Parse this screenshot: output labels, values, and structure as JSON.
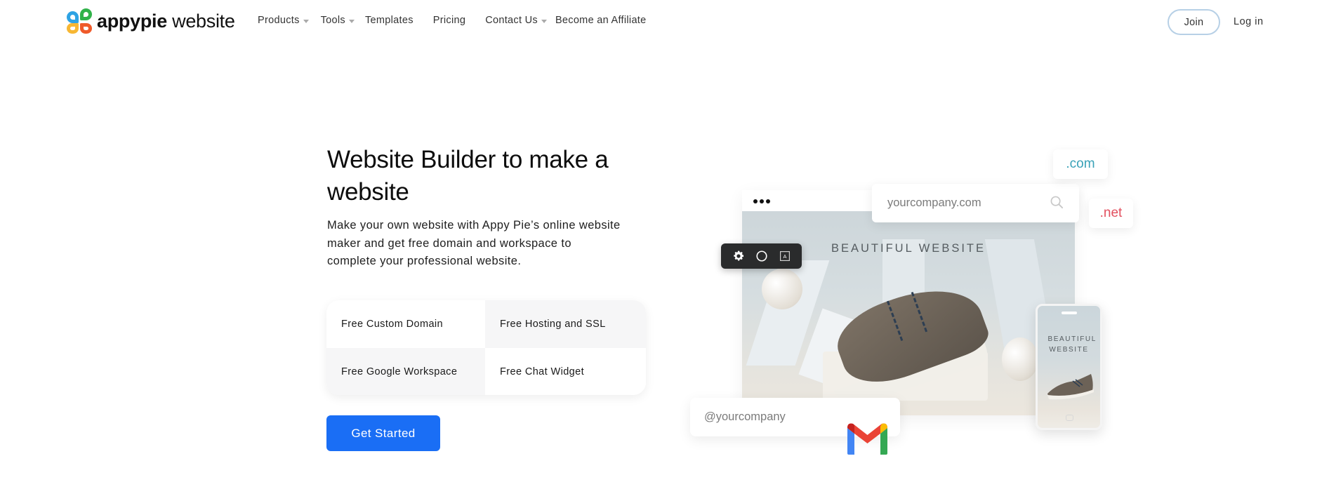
{
  "header": {
    "logo": {
      "brand": "appypie",
      "product": "website",
      "icon": "appypie-clover-logo-icon"
    },
    "nav": [
      {
        "label": "Products",
        "has_dropdown": true
      },
      {
        "label": "Tools",
        "has_dropdown": true
      },
      {
        "label": "Templates",
        "has_dropdown": false
      },
      {
        "label": "Pricing",
        "has_dropdown": false
      },
      {
        "label": "Contact Us",
        "has_dropdown": true
      },
      {
        "label": "Become an Affiliate",
        "has_dropdown": false
      }
    ],
    "join_label": "Join",
    "login_label": "Log in"
  },
  "hero": {
    "title": "Website Builder to make a website",
    "description": "Make your own website with Appy Pie’s online website maker and get free domain and workspace to complete your professional website.",
    "features": [
      "Free Custom Domain",
      "Free Hosting and SSL",
      "Free Google Workspace",
      "Free Chat Widget"
    ],
    "cta_label": "Get Started",
    "cta_color": "#1a6ef5"
  },
  "illustration": {
    "banner_text": "BEAUTIFUL WEBSITE",
    "phone_text": "BEAUTIFUL WEBSITE",
    "domain_search_value": "yourcompany.com",
    "tld_options": [
      ".com",
      ".net"
    ],
    "email_value": "@yourcompany",
    "toolbar_icons": [
      "gear-icon",
      "circle-icon",
      "text-box-icon"
    ],
    "colors": {
      "com": "#3aa2b8",
      "net": "#e2505f"
    }
  }
}
